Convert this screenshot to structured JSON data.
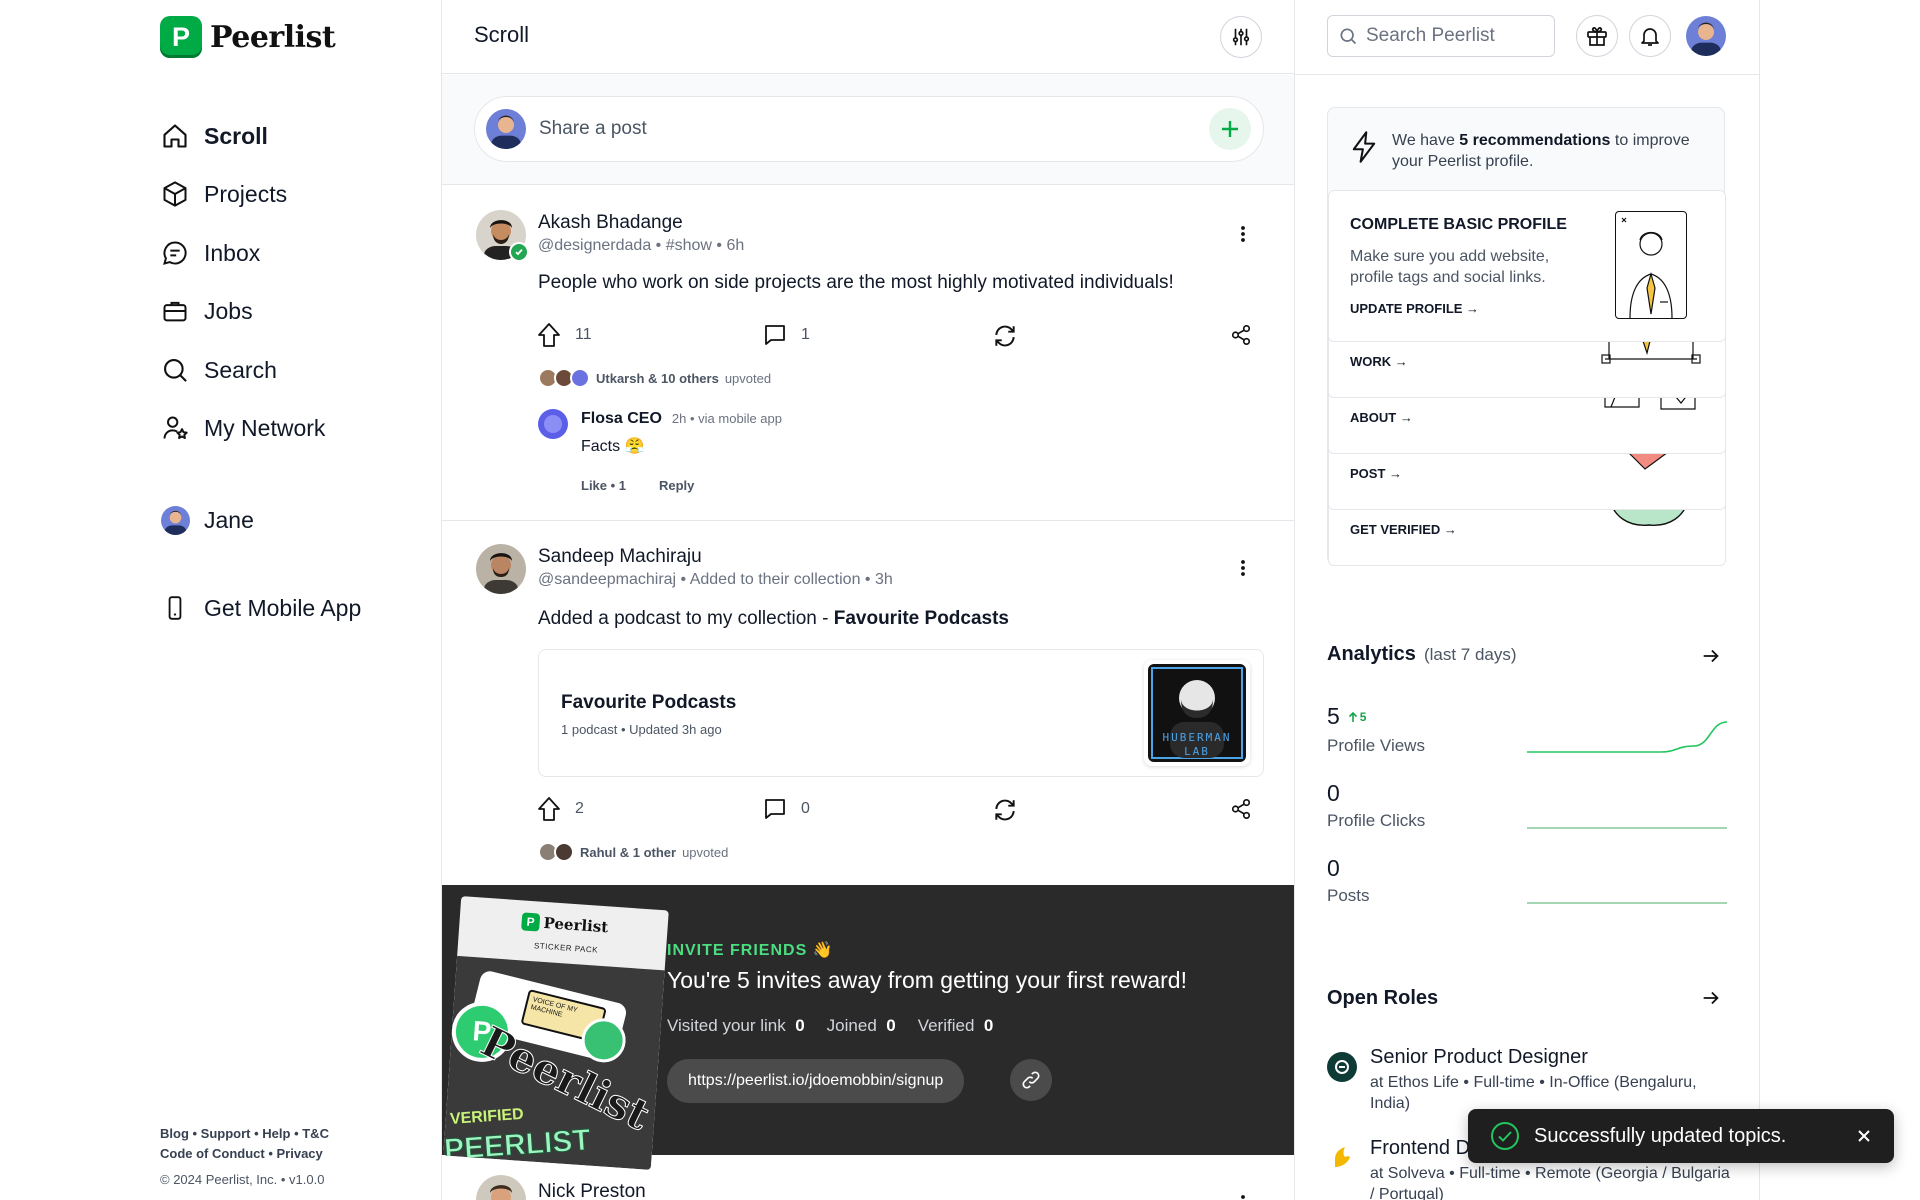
{
  "brand": {
    "name": "Peerlist",
    "mark": "P"
  },
  "nav": {
    "items": [
      {
        "label": "Scroll",
        "icon": "home-icon",
        "active": true
      },
      {
        "label": "Projects",
        "icon": "cube-icon"
      },
      {
        "label": "Inbox",
        "icon": "chat-icon"
      },
      {
        "label": "Jobs",
        "icon": "briefcase-icon"
      },
      {
        "label": "Search",
        "icon": "search-icon"
      },
      {
        "label": "My Network",
        "icon": "network-icon"
      }
    ],
    "profile": "Jane",
    "mobile_app": "Get Mobile App"
  },
  "footer": {
    "line1": [
      "Blog",
      "Support",
      "Help",
      "T&C"
    ],
    "line2": [
      "Code of Conduct",
      "Privacy"
    ],
    "copyright": "© 2024 Peerlist, Inc. • v1.0.0"
  },
  "main": {
    "title": "Scroll",
    "composer_placeholder": "Share a post",
    "posts": [
      {
        "name": "Akash Bhadange",
        "handle": "@designerdada",
        "tag": "#show",
        "time": "6h",
        "verified": true,
        "body": "People who work on side projects are the most highly motivated individuals!",
        "upvotes": "11",
        "comments": "1",
        "upvoted_by": "Utkarsh & 10 others",
        "upvoted_suffix": "upvoted",
        "comment": {
          "name": "Flosa CEO",
          "time": "2h",
          "via": "via mobile app",
          "text": "Facts",
          "emoji": "😤",
          "like": "Like • 1",
          "reply": "Reply"
        }
      },
      {
        "name": "Sandeep Machiraju",
        "handle": "@sandeepmachiraj",
        "tag": "Added to their collection",
        "time": "3h",
        "body_prefix": "Added a podcast to my collection - ",
        "body_bold": "Favourite Podcasts",
        "card_title": "Favourite Podcasts",
        "card_meta": "1 podcast • Updated 3h ago",
        "card_art_text": "HUBERMAN LAB",
        "upvotes": "2",
        "comments": "0",
        "upvoted_by": "Rahul & 1 other",
        "upvoted_suffix": "upvoted"
      }
    ],
    "invite": {
      "kicker": "INVITE FRIENDS 👋",
      "headline": "You're 5 invites away from getting your first reward!",
      "stats": [
        {
          "label": "Visited your link",
          "value": "0"
        },
        {
          "label": "Joined",
          "value": "0"
        },
        {
          "label": "Verified",
          "value": "0"
        }
      ],
      "link": "https://peerlist.io/jdoemobbin/signup",
      "sticker_brand": "Peerlist",
      "sticker_caption": "STICKER PACK",
      "sticker_words": [
        "Peerlist",
        "VERIFIED",
        "PEERLIST",
        "VOICE OF MY MACHINE"
      ]
    },
    "next_post_name": "Nick Preston"
  },
  "right": {
    "search_placeholder": "Search Peerlist",
    "reco": {
      "intro_prefix": "We have ",
      "intro_bold": "5 recommendations",
      "intro_suffix": " to improve your Peerlist profile.",
      "card_title": "COMPLETE BASIC PROFILE",
      "card_text": "Make sure you add website, profile tags and social links.",
      "card_cta": "UPDATE PROFILE →",
      "links": [
        "WORK →",
        "ABOUT →",
        "POST →",
        "GET VERIFIED →"
      ]
    },
    "analytics": {
      "title": "Analytics",
      "period": "(last 7 days)",
      "stats": [
        {
          "value": "5",
          "delta": "5",
          "label": "Profile Views",
          "trend": [
            0,
            0,
            0,
            0,
            0,
            1,
            5
          ]
        },
        {
          "value": "0",
          "label": "Profile Clicks",
          "trend": [
            0,
            0,
            0,
            0,
            0,
            0,
            0
          ]
        },
        {
          "value": "0",
          "label": "Posts",
          "trend": [
            0,
            0,
            0,
            0,
            0,
            0,
            0
          ]
        }
      ]
    },
    "roles": {
      "title": "Open Roles",
      "items": [
        {
          "title": "Senior Product Designer",
          "meta": "at Ethos Life • Full-time • In-Office (Bengaluru, India)"
        },
        {
          "title": "Frontend D",
          "meta": "at Solveva • Full-time • Remote (Georgia / Bulgaria / Portugal)"
        }
      ]
    }
  },
  "toast": {
    "message": "Successfully updated topics."
  },
  "colors": {
    "brand": "#00aa45",
    "trend": "#22c55e",
    "dark_panel": "#2a2a2a",
    "invite_kicker": "#4ade80"
  }
}
